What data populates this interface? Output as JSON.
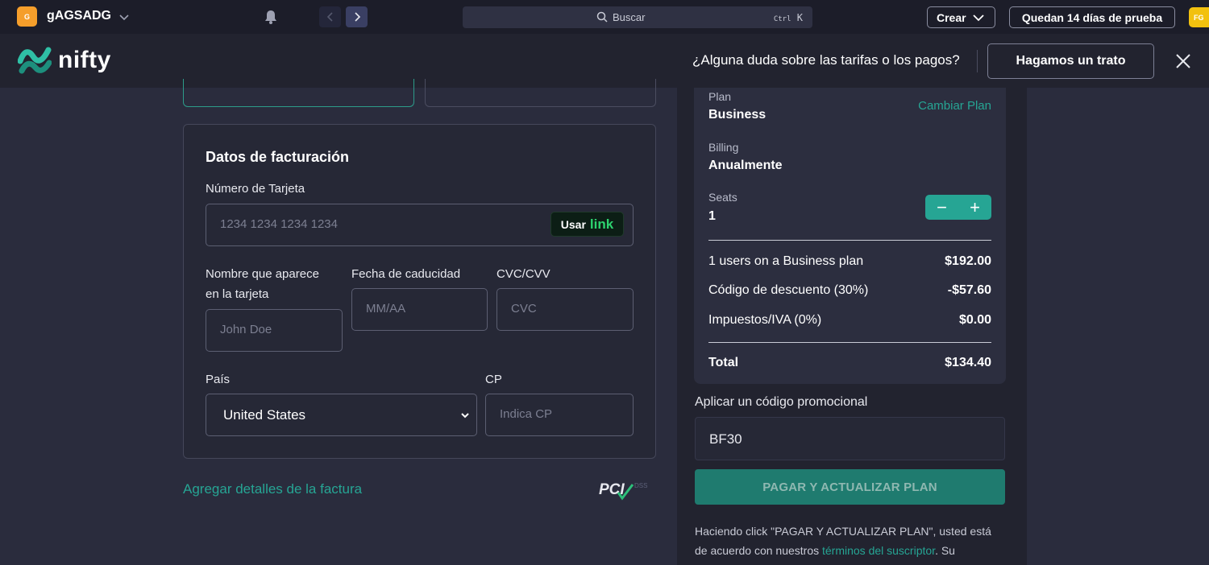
{
  "topbar": {
    "workspace_initial": "G",
    "workspace_name": "gAGSADG",
    "search_placeholder": "Buscar",
    "search_kbd_ctrl": "Ctrl",
    "search_kbd_key": "K",
    "create_label": "Crear",
    "trial_label": "Quedan 14 días de prueba",
    "avatar_initials": "FG"
  },
  "header": {
    "brand": "nifty",
    "question": "¿Alguna duda sobre las tarifas o los pagos?",
    "deal_button": "Hagamos un trato"
  },
  "billing": {
    "title": "Datos de facturación",
    "card_number_label": "Número de Tarjeta",
    "card_number_placeholder": "1234 1234 1234 1234",
    "link_usar": "Usar",
    "link_word": "link",
    "name_label_line1": "Nombre que aparece",
    "name_label_line2": "en la tarjeta",
    "name_placeholder": "John Doe",
    "expiry_label": "Fecha de caducidad",
    "expiry_placeholder": "MM/AA",
    "cvc_label": "CVC/CVV",
    "cvc_placeholder": "CVC",
    "country_label": "País",
    "country_value": "United States",
    "zip_label": "CP",
    "zip_placeholder": "Indica CP",
    "add_details": "Agregar detalles de la factura",
    "pci_text": "PCI",
    "pci_sub": "DSS"
  },
  "summary": {
    "plan_label": "Plan",
    "plan_value": "Business",
    "change_plan": "Cambiar Plan",
    "billing_label": "Billing",
    "billing_value": "Anualmente",
    "seats_label": "Seats",
    "seats_value": "1",
    "minus": "−",
    "plus": "+",
    "rows": [
      {
        "label": "1 users on a Business plan",
        "value": "$192.00"
      },
      {
        "label": "Código de descuento (30%)",
        "value": "-$57.60"
      },
      {
        "label": "Impuestos/IVA (0%)",
        "value": "$0.00"
      }
    ],
    "total_label": "Total",
    "total_value": "$134.40"
  },
  "promo": {
    "label": "Aplicar un código promocional",
    "value": "BF30"
  },
  "pay_button": "PAGAR Y ACTUALIZAR PLAN",
  "terms": {
    "line1": "Haciendo click \"PAGAR Y ACTUALIZAR PLAN\", usted está",
    "line2_prefix": "de acuerdo con nuestros ",
    "line2_link": "términos del suscriptor",
    "line2_suffix": ". Su"
  },
  "colors": {
    "accent": "#26a594",
    "background": "#2a2c3d",
    "topbar": "#1c1d29",
    "workspace_logo": "#f59e2b",
    "avatar": "#f2c10f",
    "link_green": "#2dd36f"
  }
}
